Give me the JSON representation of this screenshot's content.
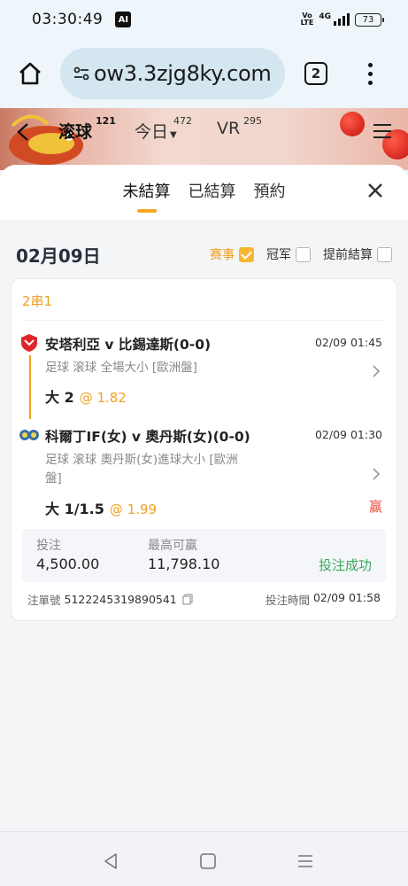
{
  "status_bar": {
    "time": "03:30:49",
    "ai_badge": "AI",
    "volte": "Vo LTE",
    "network": "4G",
    "battery": "73"
  },
  "browser": {
    "url": "ow3.3zjg8ky.com",
    "tab_count": "2"
  },
  "site_nav": {
    "items": [
      {
        "label": "滚球",
        "count": "121"
      },
      {
        "label": "今日",
        "count": "472"
      },
      {
        "label": "VR",
        "count": "295"
      }
    ]
  },
  "panel": {
    "tabs": [
      "未結算",
      "已結算",
      "預約"
    ],
    "active_tab": "未結算"
  },
  "filter": {
    "date": "02月09日",
    "options": [
      {
        "label": "赛事",
        "checked": true
      },
      {
        "label": "冠军",
        "checked": false
      },
      {
        "label": "提前結算",
        "checked": false
      }
    ]
  },
  "bet": {
    "type": "2串1",
    "legs": [
      {
        "match": "安塔利亞 v 比錫達斯(0-0)",
        "time": "02/09 01:45",
        "market_line1": "足球  滚球   全場大小 [歐洲盤]",
        "market_line2": "",
        "pick": "大 2",
        "odds": "@ 1.82",
        "result": ""
      },
      {
        "match": "科爾丁IF(女) v 奧丹斯(女)(0-0)",
        "time": "02/09 01:30",
        "market_line1": "足球  滚球   奧丹斯(女)進球大小 [歐洲",
        "market_line2": "盤]",
        "pick": "大 1/1.5",
        "odds": "@ 1.99",
        "result": "赢"
      }
    ],
    "stake_label": "投注",
    "stake": "4,500.00",
    "max_win_label": "最高可赢",
    "max_win": "11,798.10",
    "status": "投注成功",
    "ticket_label": "注單號",
    "ticket_no": "5122245319890541",
    "time_label": "投注時間",
    "bet_time": "02/09 01:58"
  }
}
